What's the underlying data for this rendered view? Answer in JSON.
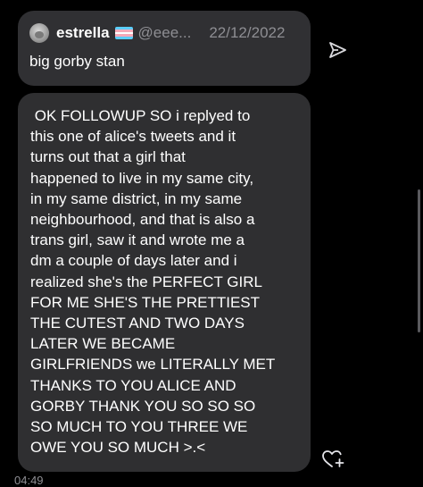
{
  "shared_tweet": {
    "display_name": "estrella",
    "handle": "@eee...",
    "date": "22/12/2022",
    "text": "big gorby stan",
    "flag_icon": "trans-flag-icon",
    "flag_colors": [
      "#5bcefa",
      "#f5a9b8",
      "#ffffff",
      "#f5a9b8",
      "#5bcefa"
    ]
  },
  "message": {
    "lines": [
      " OK FOLLOWUP SO i replyed to",
      "this one of alice's tweets and it",
      "turns out that a girl that",
      "happened to live in my same city,",
      "in my same district, in my same",
      "neighbourhood, and that is also a",
      "trans girl, saw it and wrote me a",
      "dm a couple of days later and i",
      "realized she's the PERFECT GIRL",
      "FOR ME SHE'S THE PRETTIEST",
      "THE CUTEST AND TWO DAYS",
      "LATER WE BECAME",
      "GIRLFRIENDS we LITERALLY MET",
      "THANKS TO YOU ALICE AND",
      "GORBY THANK YOU SO SO SO",
      "SO MUCH TO YOU THREE WE",
      "OWE YOU SO MUCH >.<"
    ],
    "timestamp": "04:49"
  },
  "icons": {
    "send": "send-icon",
    "react": "add-reaction-heart-icon"
  }
}
